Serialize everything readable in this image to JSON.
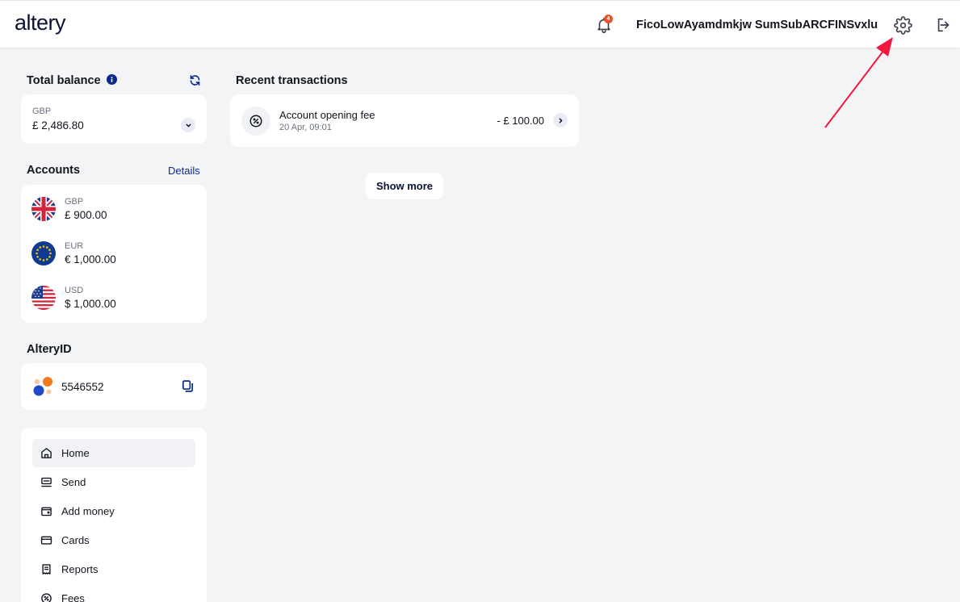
{
  "header": {
    "logo": "altery",
    "notifications_count": "4",
    "username": "FicoLowAyamdmkjw SumSubARCFINSvxlu"
  },
  "balance": {
    "title": "Total balance",
    "currency": "GBP",
    "amount": "£ 2,486.80"
  },
  "accounts": {
    "title": "Accounts",
    "details_link": "Details",
    "items": [
      {
        "currency": "GBP",
        "amount": "£ 900.00",
        "flag": "uk-flag-icon"
      },
      {
        "currency": "EUR",
        "amount": "€ 1,000.00",
        "flag": "eu-flag-icon"
      },
      {
        "currency": "USD",
        "amount": "$ 1,000.00",
        "flag": "us-flag-icon"
      }
    ]
  },
  "altery_id": {
    "title": "AlteryID",
    "value": "5546552"
  },
  "nav": {
    "items": [
      {
        "label": "Home",
        "active": true
      },
      {
        "label": "Send"
      },
      {
        "label": "Add money"
      },
      {
        "label": "Cards"
      },
      {
        "label": "Reports"
      },
      {
        "label": "Fees"
      }
    ]
  },
  "transactions": {
    "title": "Recent transactions",
    "items": [
      {
        "name": "Account opening fee",
        "date": "20 Apr, 09:01",
        "amount": "- £ 100.00"
      }
    ],
    "show_more": "Show more"
  },
  "colors": {
    "accent": "#0b2a8f",
    "background": "#f3f4f6",
    "badge": "#e5532a",
    "annotation_arrow": "#f0183f"
  }
}
